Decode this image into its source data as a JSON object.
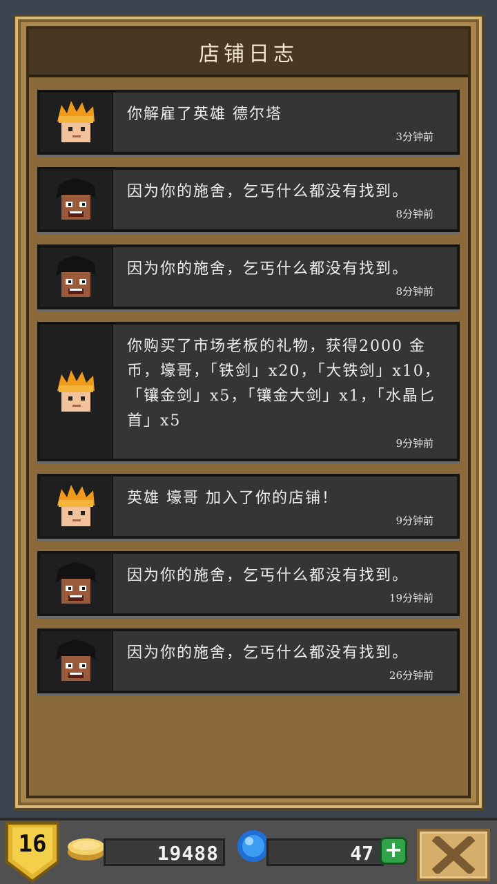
{
  "header": {
    "title": "店铺日志"
  },
  "log": [
    {
      "avatar": "hero-orange-hair",
      "text": "你解雇了英雄 德尔塔",
      "time": "3分钟前"
    },
    {
      "avatar": "beggar-dark-hair",
      "text": "因为你的施舍，乞丐什么都没有找到。",
      "time": "8分钟前"
    },
    {
      "avatar": "beggar-dark-hair",
      "text": "因为你的施舍，乞丐什么都没有找到。",
      "time": "8分钟前"
    },
    {
      "avatar": "hero-orange-hair",
      "text": "你购买了市场老板的礼物，获得2000 金币，壕哥，「铁剑」x20，「大铁剑」x10，「镶金剑」x5，「镶金大剑」x1，「水晶匕首」x5",
      "time": "9分钟前"
    },
    {
      "avatar": "hero-orange-hair",
      "text": "英雄 壕哥 加入了你的店铺！",
      "time": "9分钟前"
    },
    {
      "avatar": "beggar-dark-hair",
      "text": "因为你的施舍，乞丐什么都没有找到。",
      "time": "19分钟前"
    },
    {
      "avatar": "beggar-dark-hair",
      "text": "因为你的施舍，乞丐什么都没有找到。",
      "time": "26分钟前"
    }
  ],
  "bottom_bar": {
    "level": "16",
    "coins": "19488",
    "gems": "47",
    "plus_label": "+",
    "icons": {
      "coin": "coin-icon",
      "gem": "gem-icon",
      "close": "close-icon"
    }
  }
}
